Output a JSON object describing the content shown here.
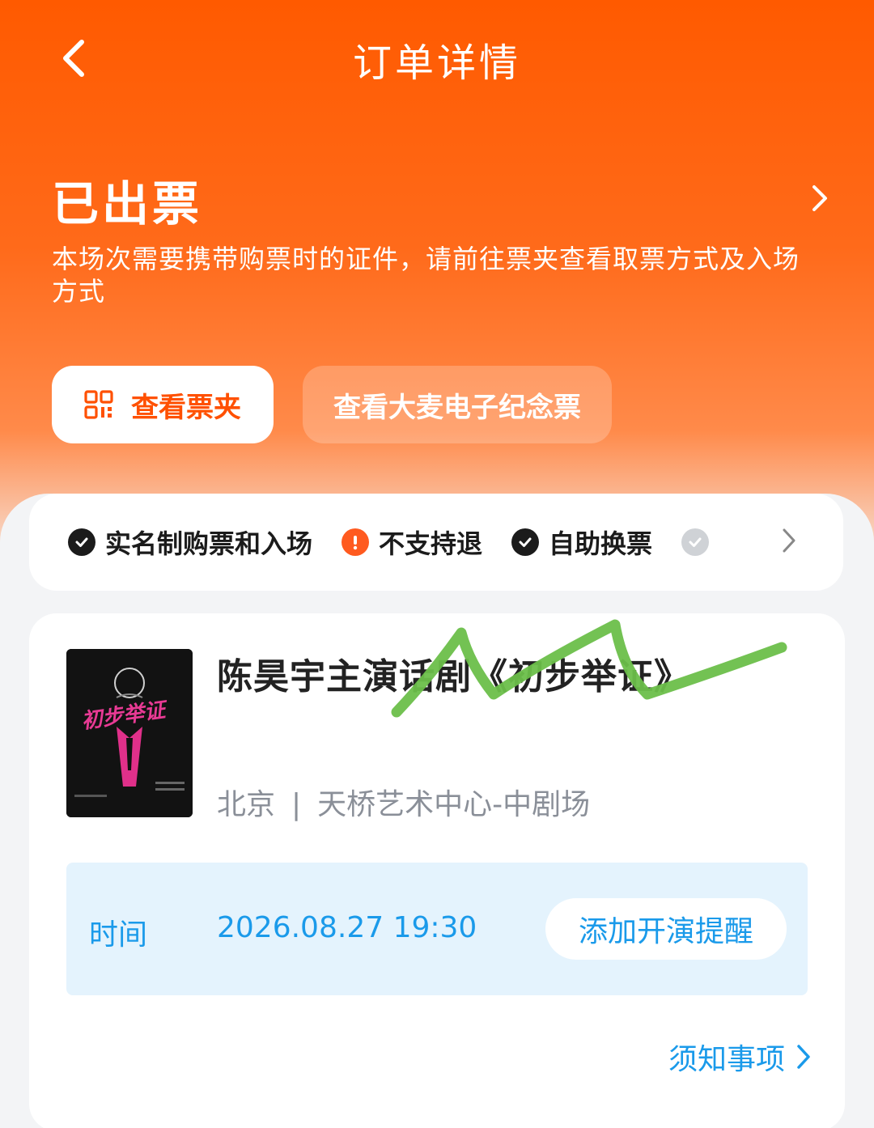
{
  "header": {
    "title": "订单详情"
  },
  "status": {
    "title": "已出票",
    "description": "本场次需要携带购票时的证件，请前往票夹查看取票方式及入场方式"
  },
  "actions": {
    "wallet_label": "查看票夹",
    "souvenir_label": "查看大麦电子纪念票"
  },
  "features": [
    {
      "label": "实名制购票和入场",
      "icon": "check-circle-icon"
    },
    {
      "label": "不支持退",
      "icon": "warning-circle-icon"
    },
    {
      "label": "自助换票",
      "icon": "check-circle-icon"
    }
  ],
  "show": {
    "title": "陈昊宇主演话剧《初步举证》",
    "city": "北京",
    "separator": "|",
    "venue": "天桥艺术中心-中剧场",
    "poster_title": "初步举证"
  },
  "time": {
    "label": "时间",
    "value": "2026.08.27 19:30",
    "remind_label": "添加开演提醒"
  },
  "notice_label": "须知事项",
  "colors": {
    "brand_orange": "#ff5000",
    "info_blue": "#1a9aea",
    "warning_orange": "#ff5a1f",
    "scribble_green": "#6cbf4a"
  }
}
